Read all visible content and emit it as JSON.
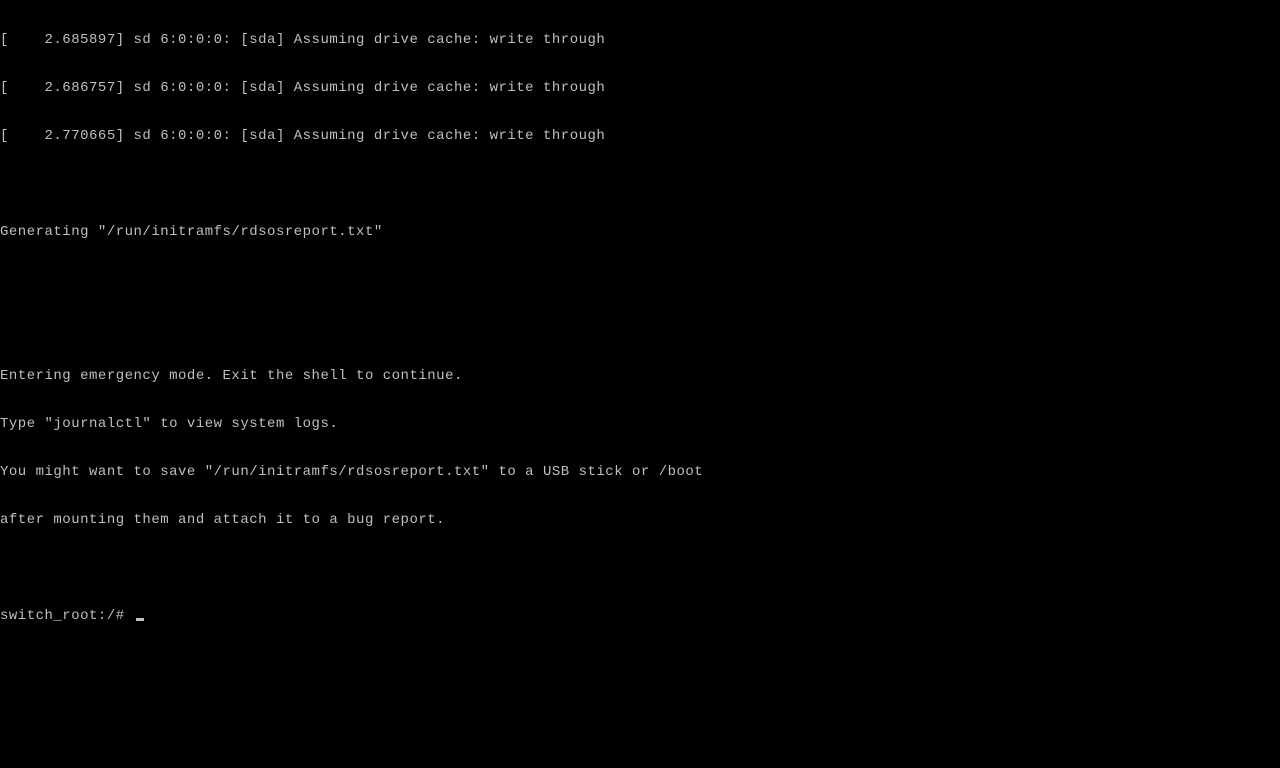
{
  "kernel_lines": [
    "[    2.685897] sd 6:0:0:0: [sda] Assuming drive cache: write through",
    "[    2.686757] sd 6:0:0:0: [sda] Assuming drive cache: write through",
    "[    2.770665] sd 6:0:0:0: [sda] Assuming drive cache: write through"
  ],
  "blank1": "",
  "generating_line": "Generating \"/run/initramfs/rdsosreport.txt\"",
  "blank2": "",
  "blank3": "",
  "emergency_lines": [
    "Entering emergency mode. Exit the shell to continue.",
    "Type \"journalctl\" to view system logs.",
    "You might want to save \"/run/initramfs/rdsosreport.txt\" to a USB stick or /boot",
    "after mounting them and attach it to a bug report."
  ],
  "blank4": "",
  "prompt": "switch_root:/# "
}
